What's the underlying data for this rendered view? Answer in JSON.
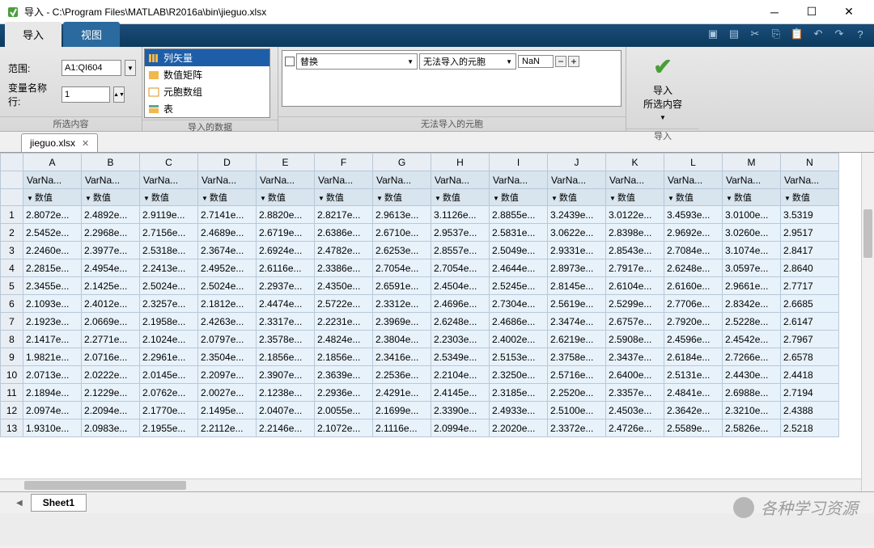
{
  "window": {
    "title": "导入 - C:\\Program Files\\MATLAB\\R2016a\\bin\\jieguo.xlsx"
  },
  "tabs": {
    "import": "导入",
    "view": "视图"
  },
  "selection": {
    "range_label": "范围:",
    "range_value": "A1:QI604",
    "varrow_label": "变量名称行:",
    "varrow_value": "1",
    "section_label": "所选内容"
  },
  "imported_types": {
    "items": [
      "列矢量",
      "数值矩阵",
      "元胞数组",
      "表"
    ],
    "selected_index": 0,
    "section_label": "导入的数据"
  },
  "unimportable": {
    "replace_label": "替换",
    "cells_label": "无法导入的元胞",
    "nan": "NaN",
    "section_label": "无法导入的元胞"
  },
  "import_button": {
    "label1": "导入",
    "label2": "所选内容",
    "section_label": "导入"
  },
  "file_tab": "jieguo.xlsx",
  "columns": [
    "A",
    "B",
    "C",
    "D",
    "E",
    "F",
    "G",
    "H",
    "I",
    "J",
    "K",
    "L",
    "M",
    "N"
  ],
  "varname_label": "VarNa...",
  "type_label": "数值",
  "rows": [
    [
      "2.8072e...",
      "2.4892e...",
      "2.9119e...",
      "2.7141e...",
      "2.8820e...",
      "2.8217e...",
      "2.9613e...",
      "3.1126e...",
      "2.8855e...",
      "3.2439e...",
      "3.0122e...",
      "3.4593e...",
      "3.0100e...",
      "3.5319"
    ],
    [
      "2.5452e...",
      "2.2968e...",
      "2.7156e...",
      "2.4689e...",
      "2.6719e...",
      "2.6386e...",
      "2.6710e...",
      "2.9537e...",
      "2.5831e...",
      "3.0622e...",
      "2.8398e...",
      "2.9692e...",
      "3.0260e...",
      "2.9517"
    ],
    [
      "2.2460e...",
      "2.3977e...",
      "2.5318e...",
      "2.3674e...",
      "2.6924e...",
      "2.4782e...",
      "2.6253e...",
      "2.8557e...",
      "2.5049e...",
      "2.9331e...",
      "2.8543e...",
      "2.7084e...",
      "3.1074e...",
      "2.8417"
    ],
    [
      "2.2815e...",
      "2.4954e...",
      "2.2413e...",
      "2.4952e...",
      "2.6116e...",
      "2.3386e...",
      "2.7054e...",
      "2.7054e...",
      "2.4644e...",
      "2.8973e...",
      "2.7917e...",
      "2.6248e...",
      "3.0597e...",
      "2.8640"
    ],
    [
      "2.3455e...",
      "2.1425e...",
      "2.5024e...",
      "2.5024e...",
      "2.2937e...",
      "2.4350e...",
      "2.6591e...",
      "2.4504e...",
      "2.5245e...",
      "2.8145e...",
      "2.6104e...",
      "2.6160e...",
      "2.9661e...",
      "2.7717"
    ],
    [
      "2.1093e...",
      "2.4012e...",
      "2.3257e...",
      "2.1812e...",
      "2.4474e...",
      "2.5722e...",
      "2.3312e...",
      "2.4696e...",
      "2.7304e...",
      "2.5619e...",
      "2.5299e...",
      "2.7706e...",
      "2.8342e...",
      "2.6685"
    ],
    [
      "2.1923e...",
      "2.0669e...",
      "2.1958e...",
      "2.4263e...",
      "2.3317e...",
      "2.2231e...",
      "2.3969e...",
      "2.6248e...",
      "2.4686e...",
      "2.3474e...",
      "2.6757e...",
      "2.7920e...",
      "2.5228e...",
      "2.6147"
    ],
    [
      "2.1417e...",
      "2.2771e...",
      "2.1024e...",
      "2.0797e...",
      "2.3578e...",
      "2.4824e...",
      "2.3804e...",
      "2.2303e...",
      "2.4002e...",
      "2.6219e...",
      "2.5908e...",
      "2.4596e...",
      "2.4542e...",
      "2.7967"
    ],
    [
      "1.9821e...",
      "2.0716e...",
      "2.2961e...",
      "2.3504e...",
      "2.1856e...",
      "2.1856e...",
      "2.3416e...",
      "2.5349e...",
      "2.5153e...",
      "2.3758e...",
      "2.3437e...",
      "2.6184e...",
      "2.7266e...",
      "2.6578"
    ],
    [
      "2.0713e...",
      "2.0222e...",
      "2.0145e...",
      "2.2097e...",
      "2.3907e...",
      "2.3639e...",
      "2.2536e...",
      "2.2104e...",
      "2.3250e...",
      "2.5716e...",
      "2.6400e...",
      "2.5131e...",
      "2.4430e...",
      "2.4418"
    ],
    [
      "2.1894e...",
      "2.1229e...",
      "2.0762e...",
      "2.0027e...",
      "2.1238e...",
      "2.2936e...",
      "2.4291e...",
      "2.4145e...",
      "2.3185e...",
      "2.2520e...",
      "2.3357e...",
      "2.4841e...",
      "2.6988e...",
      "2.7194"
    ],
    [
      "2.0974e...",
      "2.2094e...",
      "2.1770e...",
      "2.1495e...",
      "2.0407e...",
      "2.0055e...",
      "2.1699e...",
      "2.3390e...",
      "2.4933e...",
      "2.5100e...",
      "2.4503e...",
      "2.3642e...",
      "2.3210e...",
      "2.4388"
    ],
    [
      "1.9310e...",
      "2.0983e...",
      "2.1955e...",
      "2.2112e...",
      "2.2146e...",
      "2.1072e...",
      "2.1116e...",
      "2.0994e...",
      "2.2020e...",
      "2.3372e...",
      "2.4726e...",
      "2.5589e...",
      "2.5826e...",
      "2.5218"
    ]
  ],
  "sheet": "Sheet1",
  "watermark": "各种学习资源"
}
